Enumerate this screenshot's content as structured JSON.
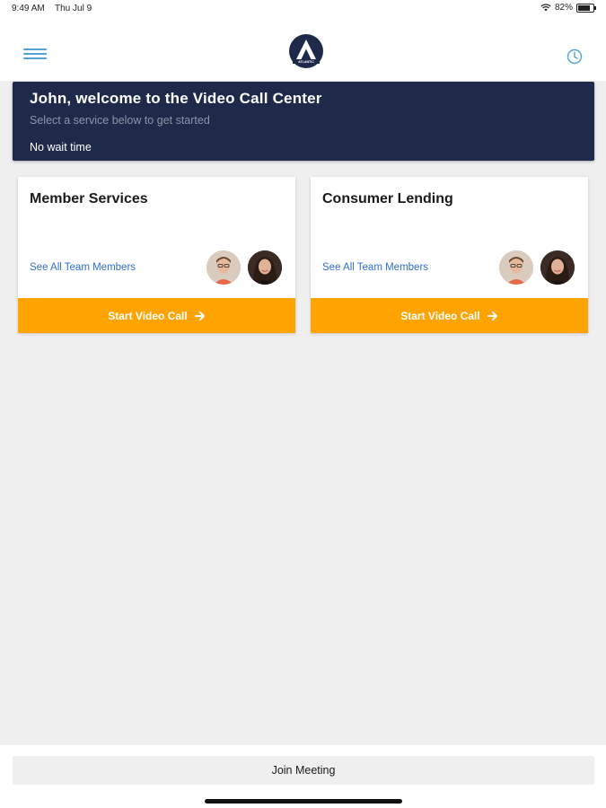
{
  "status_bar": {
    "time": "9:49 AM",
    "date": "Thu Jul 9",
    "battery": "82%",
    "battery_level": 0.82,
    "wifi_icon": "wifi-icon",
    "battery_icon": "battery-icon"
  },
  "app_bar": {
    "menu_icon": "hamburger-menu-icon",
    "logo_icon": "atlantic-logo",
    "logo_text": "ATLANTIC",
    "history_icon": "clock-icon",
    "accent_color": "#4fa3d9"
  },
  "banner": {
    "title": "John, welcome to the Video Call Center",
    "subtitle": "Select a service below to get started",
    "wait": "No wait time",
    "background": "#1f2a4b"
  },
  "services": [
    {
      "name": "Member Services",
      "team_link": "See All Team Members",
      "cta": "Start Video Call"
    },
    {
      "name": "Consumer Lending",
      "team_link": "See All Team Members",
      "cta": "Start Video Call"
    }
  ],
  "cta_color": "#fda402",
  "link_color": "#2d6fd0",
  "footer": {
    "join_label": "Join Meeting"
  }
}
